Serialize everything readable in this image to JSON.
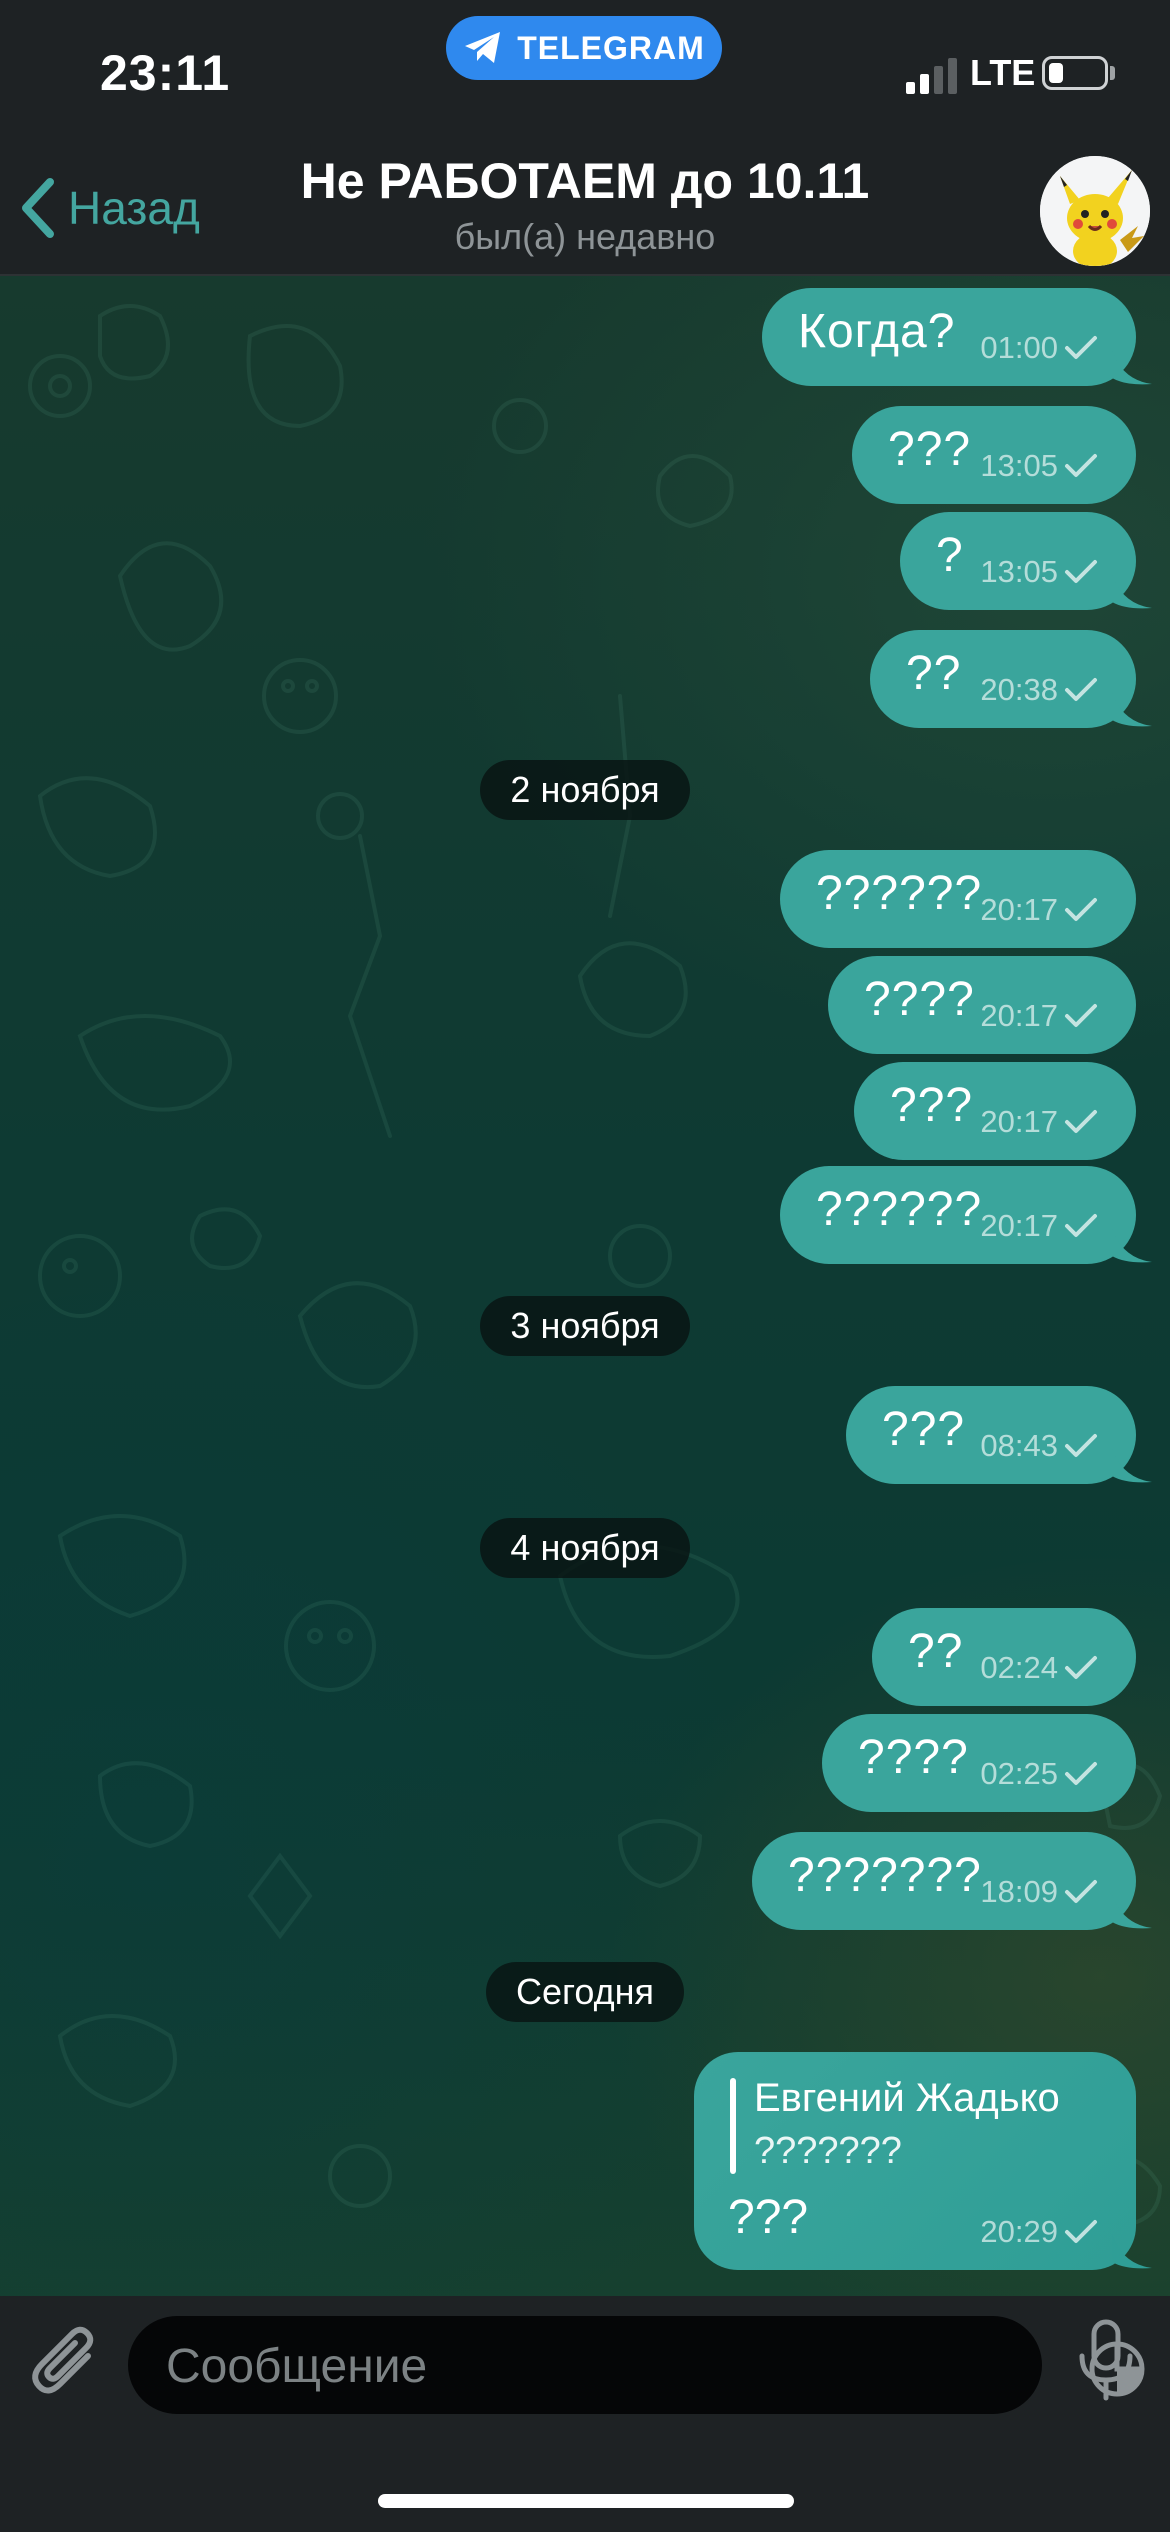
{
  "status_bar": {
    "time": "23:11",
    "app_pill": "TELEGRAM",
    "network": "LTE",
    "icons": [
      "telegram-plane-icon",
      "signal-icon",
      "battery-icon"
    ]
  },
  "header": {
    "back_label": "Назад",
    "title": "Не РАБОТАЕМ до 10.11",
    "subtitle": "был(а) недавно",
    "avatar_icon": "pikachu-avatar"
  },
  "colors": {
    "bubble": "#3aa59c",
    "accent": "#44a6a0",
    "telegram_blue": "#2f89ee"
  },
  "messages": [
    {
      "text": "Когда?",
      "time": "01:00"
    },
    {
      "text": "???",
      "time": "13:05"
    },
    {
      "text": "?",
      "time": "13:05"
    },
    {
      "text": "??",
      "time": "20:38"
    },
    {
      "text": "??????",
      "time": "20:17"
    },
    {
      "text": "????",
      "time": "20:17"
    },
    {
      "text": "???",
      "time": "20:17"
    },
    {
      "text": "??????",
      "time": "20:17"
    },
    {
      "text": "???",
      "time": "08:43"
    },
    {
      "text": "??",
      "time": "02:24"
    },
    {
      "text": "????",
      "time": "02:25"
    },
    {
      "text": "???????",
      "time": "18:09"
    }
  ],
  "dates": [
    "2 ноября",
    "3 ноября",
    "4 ноября",
    "Сегодня"
  ],
  "reply_message": {
    "reply_to_name": "Евгений Жадько",
    "reply_to_text": "???????",
    "text": "???",
    "time": "20:29"
  },
  "input": {
    "placeholder": "Сообщение",
    "value": ""
  }
}
